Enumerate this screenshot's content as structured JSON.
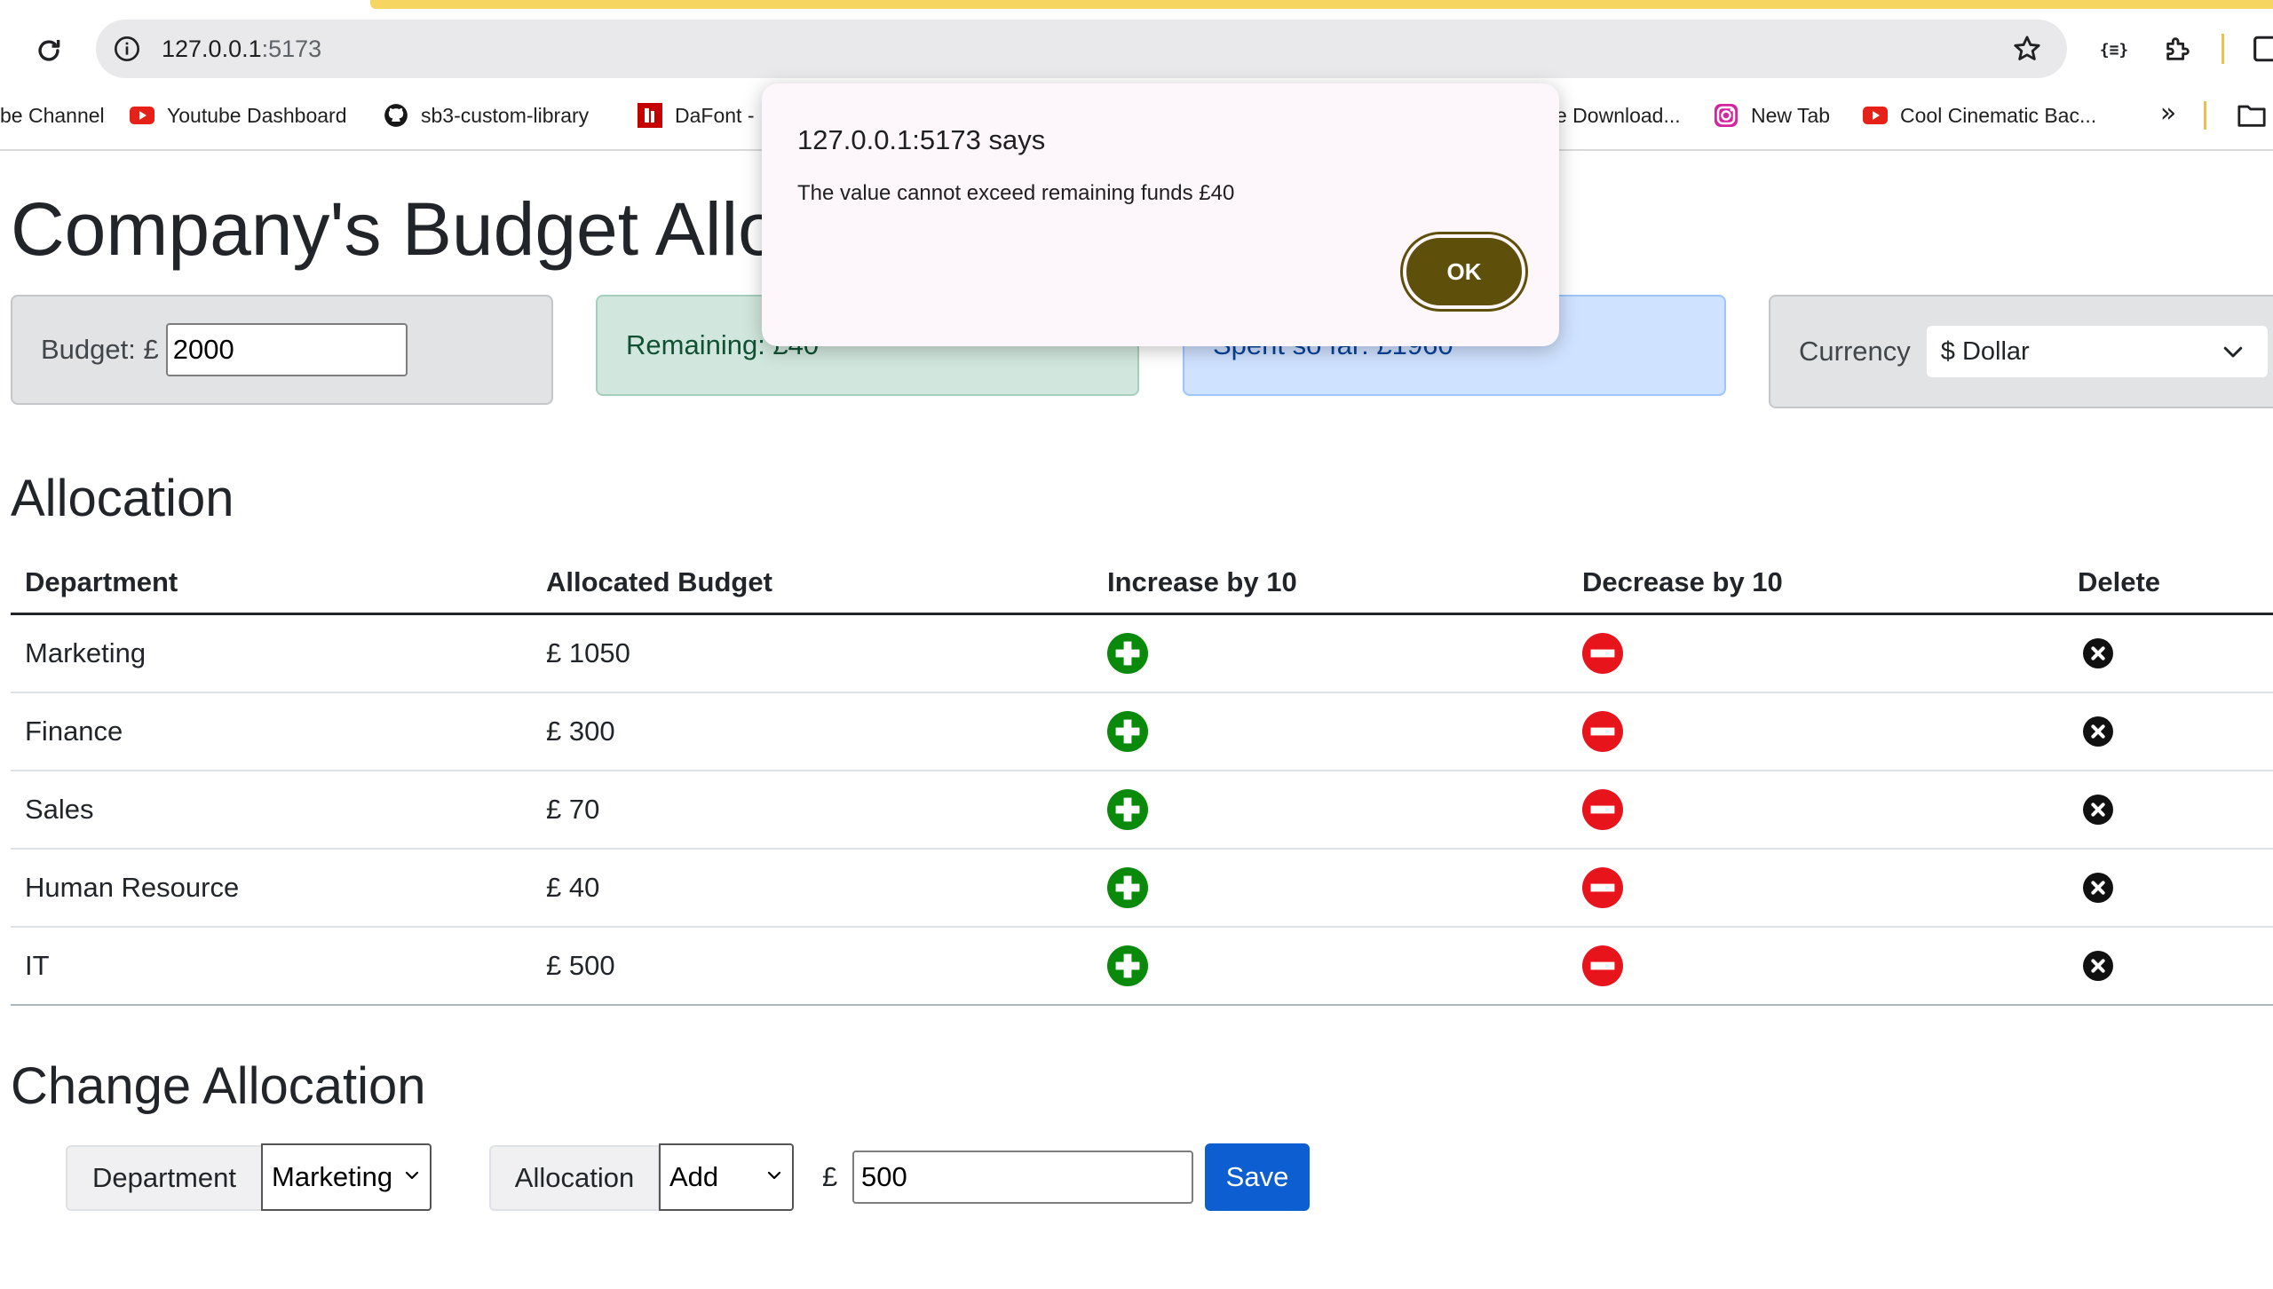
{
  "browser": {
    "url_host": "127.0.0.1",
    "url_port": ":5173",
    "bookmarks": [
      {
        "label": "be Channel",
        "icon": "youtube-icon"
      },
      {
        "label": "Youtube Dashboard",
        "icon": "youtube-icon"
      },
      {
        "label": "sb3-custom-librar​y",
        "icon": "github-icon"
      },
      {
        "label": "DaFont -",
        "icon": "dafont-icon"
      },
      {
        "label": "e Download...",
        "icon": "none"
      },
      {
        "label": "New Tab",
        "icon": "instagram-icon"
      },
      {
        "label": "Cool Cinematic Bac...",
        "icon": "youtube-icon"
      }
    ],
    "more_bookmarks": "»",
    "ext_dev_label": "{≡}"
  },
  "page": {
    "title": "Company's Budget Allocation",
    "budget": {
      "label": "Budget: £",
      "value": "2000"
    },
    "remaining": {
      "label": "Remaining: £40"
    },
    "spent": {
      "label": "Spent so far: £1960"
    },
    "currency": {
      "label": "Currency",
      "selected": "$ Dollar"
    },
    "allocation_heading": "Allocation",
    "table": {
      "headers": [
        "Department",
        "Allocated Budget",
        "Increase by 10",
        "Decrease by 10",
        "Delete"
      ],
      "rows": [
        {
          "department": "Marketing",
          "budget": "£ 1050"
        },
        {
          "department": "Finance",
          "budget": "£ 300"
        },
        {
          "department": "Sales",
          "budget": "£ 70"
        },
        {
          "department": "Human Resource",
          "budget": "£ 40"
        },
        {
          "department": "IT",
          "budget": "£ 500"
        }
      ]
    },
    "change_heading": "Change Allocation",
    "form": {
      "department_label": "Department",
      "department_value": "Marketing",
      "allocation_label": "Allocation",
      "allocation_value": "Add",
      "currency_symbol": "£",
      "amount": "500",
      "save_label": "Save"
    }
  },
  "dialog": {
    "title": "127.0.0.1:5173 says",
    "message": "The value cannot exceed remaining funds  £40",
    "ok_label": "OK"
  },
  "colors": {
    "increase": "#0a8a0a",
    "decrease": "#e8141b",
    "ok_button": "#5e4f0a"
  }
}
